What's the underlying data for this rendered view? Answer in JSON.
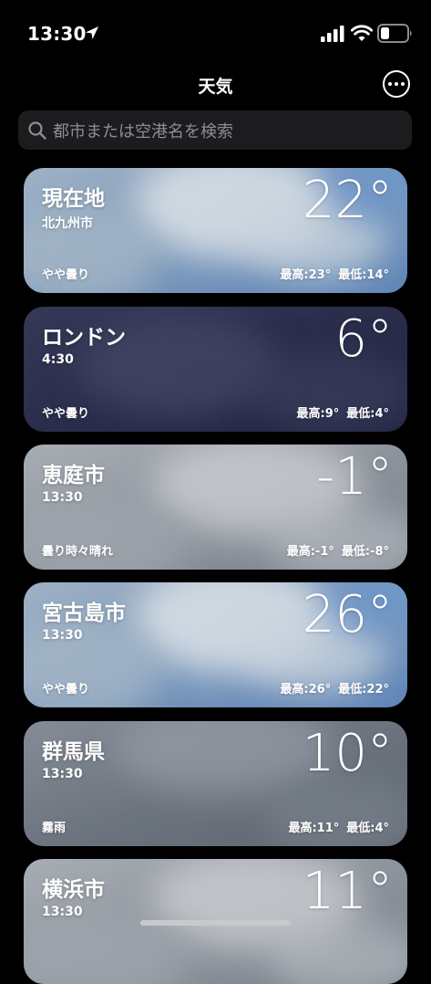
{
  "status_bar": {
    "time": "13:30",
    "icons": [
      "location-arrow-icon",
      "signal-icon",
      "wifi-icon",
      "battery-icon"
    ]
  },
  "header": {
    "title": "天気",
    "more_icon": "ellipsis-circle-icon"
  },
  "search": {
    "icon": "search-icon",
    "placeholder": "都市または空港名を検索"
  },
  "cities": [
    {
      "name": "現在地",
      "sub": "北九州市",
      "temp": "22°",
      "condition": "やや曇り",
      "high": "最高:23°",
      "low": "最低:14°",
      "theme": "cloudy-blue"
    },
    {
      "name": "ロンドン",
      "sub": "4:30",
      "temp": "6°",
      "condition": "やや曇り",
      "high": "最高:9°",
      "low": "最低:4°",
      "theme": "night"
    },
    {
      "name": "恵庭市",
      "sub": "13:30",
      "temp": "-1°",
      "condition": "曇り時々晴れ",
      "high": "最高:-1°",
      "low": "最低:-8°",
      "theme": "overcast"
    },
    {
      "name": "宮古島市",
      "sub": "13:30",
      "temp": "26°",
      "condition": "やや曇り",
      "high": "最高:26°",
      "low": "最低:22°",
      "theme": "cloudy-blue"
    },
    {
      "name": "群馬県",
      "sub": "13:30",
      "temp": "10°",
      "condition": "霧雨",
      "high": "最高:11°",
      "low": "最低:4°",
      "theme": "rain"
    },
    {
      "name": "横浜市",
      "sub": "13:30",
      "temp": "11°",
      "condition": "",
      "high": "",
      "low": "",
      "theme": "overcast"
    }
  ],
  "colors": {
    "background": "#000000",
    "search_bg": "#1c1c1e",
    "placeholder": "#8d8d92",
    "cloudy_blue": "#6e8eb6",
    "night": "#2b2f4e",
    "overcast": "#8d949e",
    "rain": "#6b747f"
  }
}
